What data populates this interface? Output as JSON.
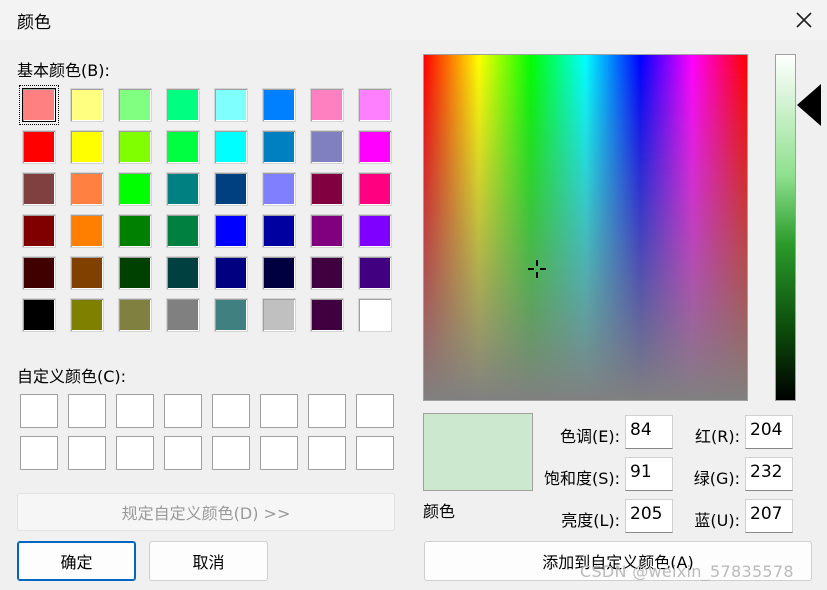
{
  "window": {
    "title": "颜色"
  },
  "basic_colors": {
    "label": "基本颜色(B):",
    "rows": [
      [
        "#ff8080",
        "#ffff80",
        "#80ff80",
        "#00ff80",
        "#80ffff",
        "#0080ff",
        "#ff80c0",
        "#ff80ff"
      ],
      [
        "#ff0000",
        "#ffff00",
        "#80ff00",
        "#00ff40",
        "#00ffff",
        "#0080c0",
        "#8080c0",
        "#ff00ff"
      ],
      [
        "#804040",
        "#ff8040",
        "#00ff00",
        "#008080",
        "#004080",
        "#8080ff",
        "#800040",
        "#ff0080"
      ],
      [
        "#800000",
        "#ff8000",
        "#008000",
        "#008040",
        "#0000ff",
        "#0000a0",
        "#800080",
        "#8000ff"
      ],
      [
        "#400000",
        "#804000",
        "#004000",
        "#004040",
        "#000080",
        "#000040",
        "#400040",
        "#400080"
      ],
      [
        "#000000",
        "#808000",
        "#808040",
        "#808080",
        "#408080",
        "#c0c0c0",
        "#400040",
        "#ffffff"
      ]
    ],
    "selected": "#ff8080"
  },
  "custom_colors": {
    "label": "自定义颜色(C):"
  },
  "buttons": {
    "define_custom": "规定自定义颜色(D) >>",
    "ok": "确定",
    "cancel": "取消",
    "add_custom": "添加到自定义颜色(A)"
  },
  "preview": {
    "label": "颜色",
    "color": "#cce8cf"
  },
  "fields": {
    "hue_label": "色调(E):",
    "hue": "84",
    "sat_label": "饱和度(S):",
    "sat": "91",
    "lum_label": "亮度(L):",
    "lum": "205",
    "red_label": "红(R):",
    "red": "204",
    "green_label": "绿(G):",
    "green": "232",
    "blue_label": "蓝(U):",
    "blue": "207"
  },
  "watermark": "CSDN @weixin_57835578"
}
